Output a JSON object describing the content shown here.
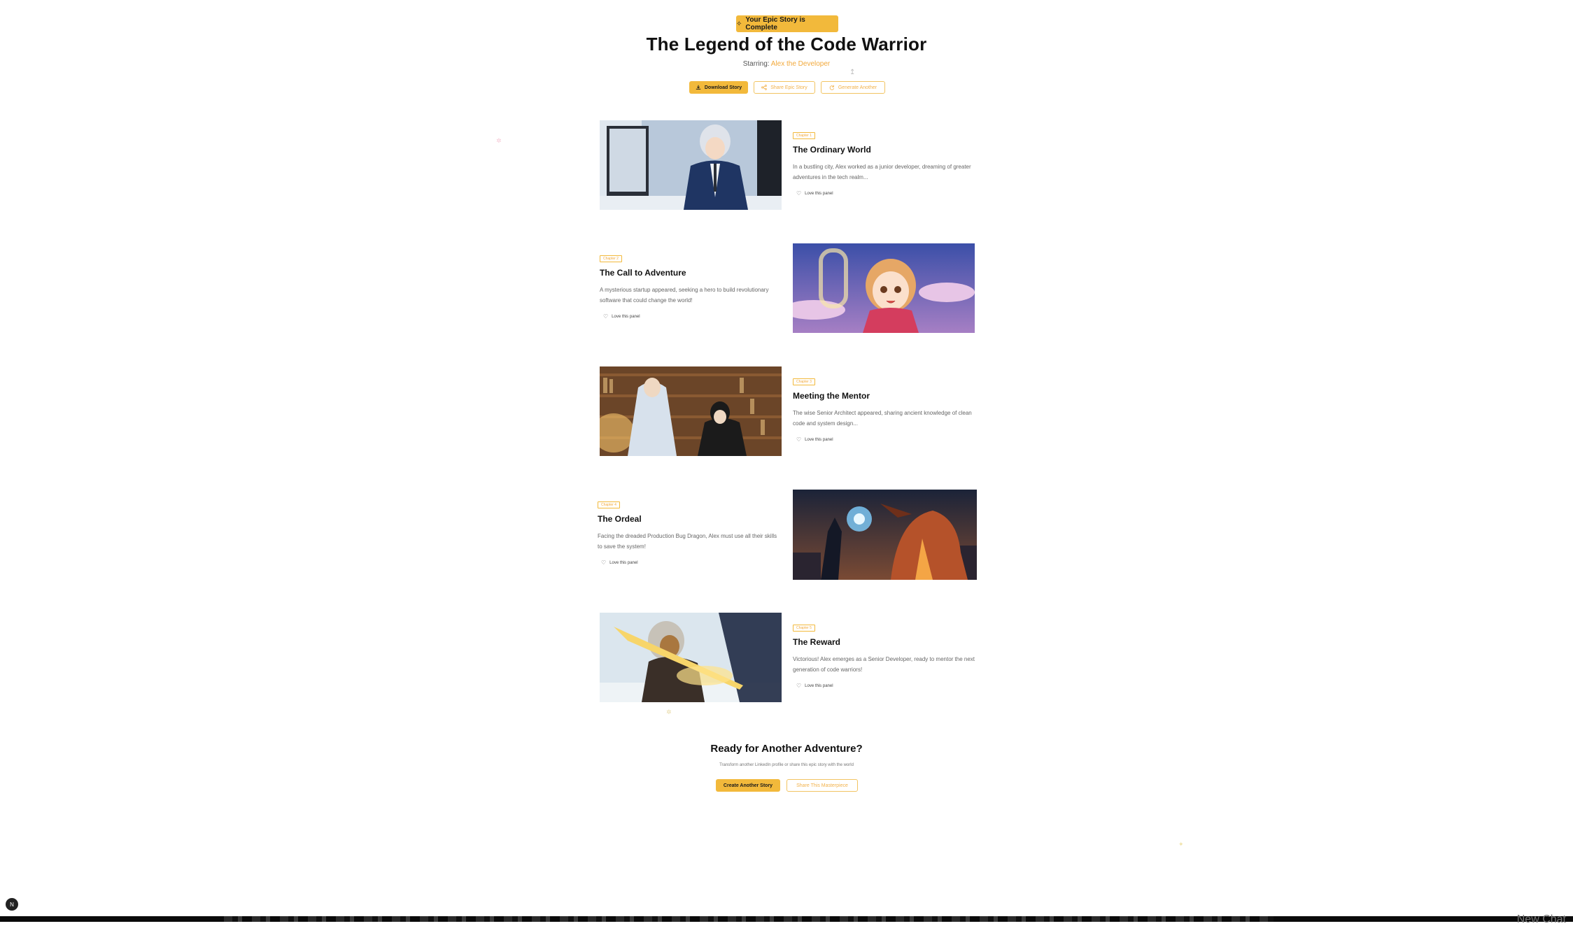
{
  "header": {
    "badge_icon": "star-icon",
    "badge": "Your Epic Story is Complete",
    "title": "The Legend of the Code Warrior",
    "starring_label": "Starring:",
    "starring_name": "Alex the Developer"
  },
  "actions": {
    "download": "Download Story",
    "share": "Share Epic Story",
    "generate": "Generate Another"
  },
  "panels": [
    {
      "chapter": "Chapter 1",
      "title": "The Ordinary World",
      "desc": "In a bustling city, Alex worked as a junior developer, dreaming of greater adventures in the tech realm...",
      "love": "Love this panel"
    },
    {
      "chapter": "Chapter 2",
      "title": "The Call to Adventure",
      "desc": "A mysterious startup appeared, seeking a hero to build revolutionary software that could change the world!",
      "love": "Love this panel"
    },
    {
      "chapter": "Chapter 3",
      "title": "Meeting the Mentor",
      "desc": "The wise Senior Architect appeared, sharing ancient knowledge of clean code and system design...",
      "love": "Love this panel"
    },
    {
      "chapter": "Chapter 4",
      "title": "The Ordeal",
      "desc": "Facing the dreaded Production Bug Dragon, Alex must use all their skills to save the system!",
      "love": "Love this panel"
    },
    {
      "chapter": "Chapter 5",
      "title": "The Reward",
      "desc": "Victorious! Alex emerges as a Senior Developer, ready to mentor the next generation of code warriors!",
      "love": "Love this panel"
    }
  ],
  "cta": {
    "title": "Ready for Another Adventure?",
    "subtitle": "Transform another LinkedIn profile or share this epic story with the world",
    "create": "Create Another Story",
    "share": "Share This Masterpiece"
  },
  "footer": {
    "corner_icon": "N",
    "new_chat": "New Chat"
  },
  "colors": {
    "accent": "#f2b93b",
    "accent_text": "#f2a93b"
  }
}
